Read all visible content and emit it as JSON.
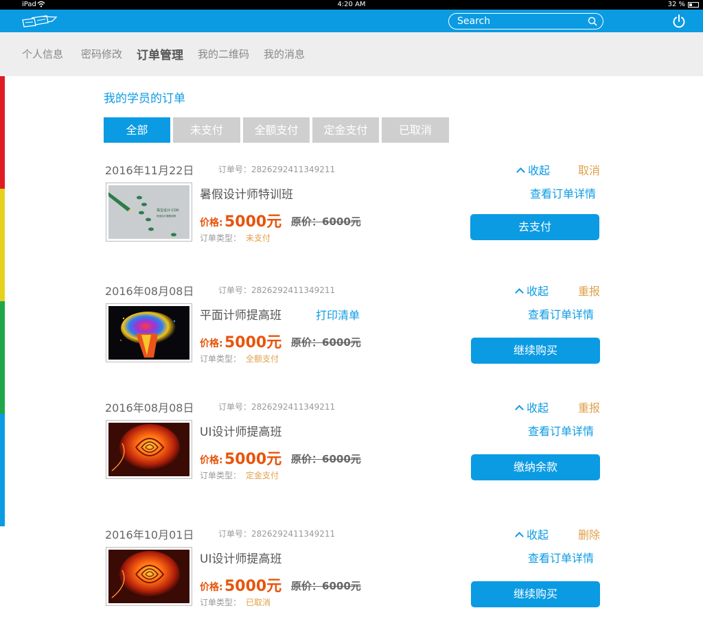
{
  "status_bar": {
    "device": "iPad",
    "time": "4:20 AM",
    "battery": "32 %"
  },
  "header": {
    "search_placeholder": "Search"
  },
  "nav": {
    "items": [
      {
        "label": "个人信息"
      },
      {
        "label": "密码修改"
      },
      {
        "label": "订单管理"
      },
      {
        "label": "我的二维码"
      },
      {
        "label": "我的消息"
      }
    ],
    "active": "订单管理"
  },
  "section_title": "我的学员的订单",
  "tabs": [
    {
      "label": "全部"
    },
    {
      "label": "未支付"
    },
    {
      "label": "全额支付"
    },
    {
      "label": "定金支付"
    },
    {
      "label": "已取消"
    }
  ],
  "colors": {
    "accent": "#0b9be3",
    "price": "#e8540c",
    "status": "#e0a04a",
    "bar": [
      "#e01b24",
      "#e6d21c",
      "#1ea84a",
      "#0b9be3"
    ]
  },
  "labels": {
    "order_no": "订单号：",
    "price": "价格:",
    "orig_price": "原价：",
    "order_type": "订单类型：",
    "collapse": "收起",
    "view_detail": "查看订单详情",
    "print": "打印清单"
  },
  "orders": [
    {
      "date": "2016年11月22日",
      "order_no": "2826292411349211",
      "action": "取消",
      "name": "暑假设计师特训班",
      "price": "5000元",
      "orig_price": "6000元",
      "type": "未支付",
      "button": "去支付",
      "image": "pencil-drawing",
      "image_text_1": "珠宝设计-CDR",
      "image_text_2": "珠宝设计课程讲解"
    },
    {
      "date": "2016年08月08日",
      "order_no": "2826292411349211",
      "action": "重报",
      "name": "平面计师提高班",
      "price": "5000元",
      "orig_price": "6000元",
      "type": "全额支付",
      "button": "继续购买",
      "image": "color-splash"
    },
    {
      "date": "2016年08月08日",
      "order_no": "2826292411349211",
      "action": "重报",
      "name": "UI设计师提高班",
      "price": "5000元",
      "orig_price": "6000元",
      "type": "定金支付",
      "button": "缴纳余款",
      "image": "fire-rose"
    },
    {
      "date": "2016年10月01日",
      "order_no": "2826292411349211",
      "action": "删除",
      "name": "UI设计师提高班",
      "price": "5000元",
      "orig_price": "6000元",
      "type": "已取消",
      "button": "继续购买",
      "image": "fire-rose"
    }
  ]
}
